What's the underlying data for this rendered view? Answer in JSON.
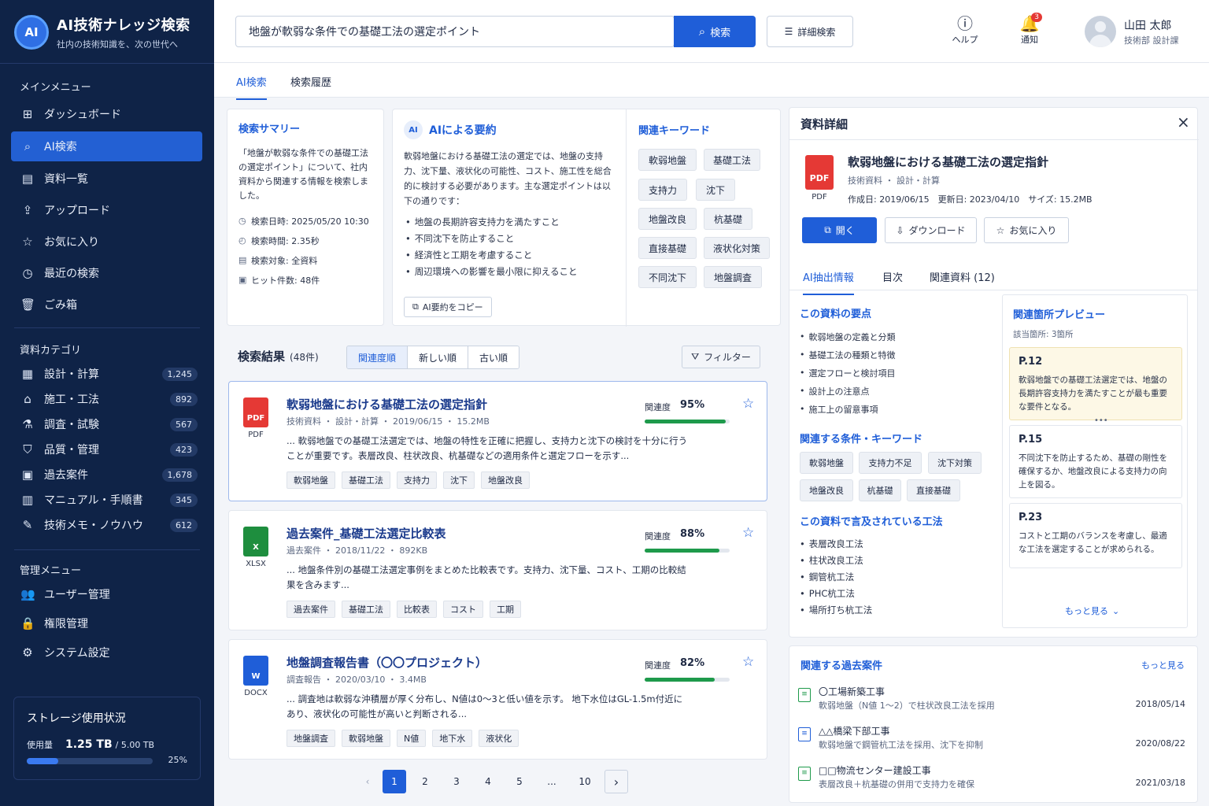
{
  "brand": {
    "title": "AI技術ナレッジ検索",
    "subtitle": "社内の技術知識を、次の世代へ",
    "logo_text": "AI"
  },
  "sidebar": {
    "main_heading": "メインメニュー",
    "main_items": [
      {
        "label": "ダッシュボード",
        "icon": "grid-icon"
      },
      {
        "label": "AI検索",
        "icon": "search-icon",
        "active": true
      },
      {
        "label": "資料一覧",
        "icon": "list-icon"
      },
      {
        "label": "アップロード",
        "icon": "upload-icon"
      },
      {
        "label": "お気に入り",
        "icon": "star-icon"
      },
      {
        "label": "最近の検索",
        "icon": "clock-icon"
      },
      {
        "label": "ごみ箱",
        "icon": "trash-icon"
      }
    ],
    "category_heading": "資料カテゴリ",
    "categories": [
      {
        "label": "設計・計算",
        "count": "1,245"
      },
      {
        "label": "施工・工法",
        "count": "892"
      },
      {
        "label": "調査・試験",
        "count": "567"
      },
      {
        "label": "品質・管理",
        "count": "423"
      },
      {
        "label": "過去案件",
        "count": "1,678"
      },
      {
        "label": "マニュアル・手順書",
        "count": "345"
      },
      {
        "label": "技術メモ・ノウハウ",
        "count": "612"
      }
    ],
    "admin_heading": "管理メニュー",
    "admin_items": [
      {
        "label": "ユーザー管理",
        "icon": "users-icon"
      },
      {
        "label": "権限管理",
        "icon": "lock-icon"
      },
      {
        "label": "システム設定",
        "icon": "gear-icon"
      }
    ],
    "storage": {
      "title": "ストレージ使用状況",
      "used_label": "使用量",
      "used": "1.25 TB",
      "total": "/ 5.00 TB",
      "percent_label": "25%",
      "percent": 25
    }
  },
  "topbar": {
    "search_value": "地盤が軟弱な条件での基礎工法の選定ポイント",
    "search_button": "検索",
    "advanced_button": "詳細検索",
    "help_label": "ヘルプ",
    "notify_label": "通知",
    "notify_count": "3",
    "user_name": "山田 太郎",
    "user_dept": "技術部 設計課"
  },
  "tabs": [
    "AI検索",
    "検索履歴"
  ],
  "summary": {
    "title": "検索サマリー",
    "text": "「地盤が軟弱な条件での基礎工法の選定ポイント」について、社内資料から関連する情報を検索しました。",
    "meta": [
      {
        "label": "検索日時: 2025/05/20 10:30"
      },
      {
        "label": "検索時間: 2.35秒"
      },
      {
        "label": "検索対象: 全資料"
      },
      {
        "label": "ヒット件数: 48件"
      }
    ]
  },
  "ai_summary": {
    "badge": "AI",
    "title": "AIによる要約",
    "text": "軟弱地盤における基礎工法の選定では、地盤の支持力、沈下量、液状化の可能性、コスト、施工性を総合的に検討する必要があります。主な選定ポイントは以下の通りです：",
    "points": [
      "地盤の長期許容支持力を満たすこと",
      "不同沈下を防止すること",
      "経済性と工期を考慮すること",
      "周辺環境への影響を最小限に抑えること"
    ],
    "copy_button": "AI要約をコピー"
  },
  "keywords": {
    "title": "関連キーワード",
    "items": [
      "軟弱地盤",
      "基礎工法",
      "支持力",
      "沈下",
      "地盤改良",
      "杭基礎",
      "直接基礎",
      "液状化対策",
      "不同沈下",
      "地盤調査"
    ]
  },
  "results": {
    "title": "検索結果",
    "count": "(48件)",
    "sort": [
      "関連度順",
      "新しい順",
      "古い順"
    ],
    "filter": "フィルター",
    "relevance_label": "関連度",
    "items": [
      {
        "type": "PDF",
        "icon_text": "PDF",
        "color": "#e53935",
        "title": "軟弱地盤における基礎工法の選定指針",
        "meta": "技術資料 ・ 設計・計算 ・ 2019/06/15 ・ 15.2MB",
        "snippet": "... 軟弱地盤での基礎工法選定では、地盤の特性を正確に把握し、支持力と沈下の検討を十分に行うことが重要です。表層改良、柱状改良、杭基礎などの適用条件と選定フローを示す...",
        "relevance": "95%",
        "relevance_value": 95,
        "tags": [
          "軟弱地盤",
          "基礎工法",
          "支持力",
          "沈下",
          "地盤改良"
        ]
      },
      {
        "type": "XLSX",
        "icon_text": "X",
        "color": "#1e8e3e",
        "title": "過去案件_基礎工法選定比較表",
        "meta": "過去案件 ・ 2018/11/22 ・ 892KB",
        "snippet": "... 地盤条件別の基礎工法選定事例をまとめた比較表です。支持力、沈下量、コスト、工期の比較結果を含みます...",
        "relevance": "88%",
        "relevance_value": 88,
        "tags": [
          "過去案件",
          "基礎工法",
          "比較表",
          "コスト",
          "工期"
        ]
      },
      {
        "type": "DOCX",
        "icon_text": "W",
        "color": "#1f5ed8",
        "title": "地盤調査報告書（〇〇プロジェクト）",
        "meta": "調査報告 ・ 2020/03/10 ・ 3.4MB",
        "snippet": "... 調査地は軟弱な沖積層が厚く分布し、N値は0〜3と低い値を示す。 地下水位はGL-1.5m付近にあり、液状化の可能性が高いと判断される...",
        "relevance": "82%",
        "relevance_value": 82,
        "tags": [
          "地盤調査",
          "軟弱地盤",
          "N値",
          "地下水",
          "液状化"
        ]
      }
    ],
    "pages": [
      "1",
      "2",
      "3",
      "4",
      "5",
      "...",
      "10"
    ]
  },
  "detail": {
    "header": "資料詳細",
    "title": "軟弱地盤における基礎工法の選定指針",
    "type": "PDF",
    "category": "技術資料 ・ 設計・計算",
    "dates": "作成日: 2019/06/15　更新日: 2023/04/10　サイズ: 15.2MB",
    "open_button": "開く",
    "download_button": "ダウンロード",
    "favorite_button": "お気に入り",
    "tabs": [
      "AI抽出情報",
      "目次",
      "関連資料 (12)"
    ],
    "key_points_title": "この資料の要点",
    "key_points": [
      "軟弱地盤の定義と分類",
      "基礎工法の種類と特徴",
      "選定フローと検討項目",
      "設計上の注意点",
      "施工上の留意事項"
    ],
    "conditions_title": "関連する条件・キーワード",
    "conditions": [
      "軟弱地盤",
      "支持力不足",
      "沈下対策",
      "地盤改良",
      "杭基礎",
      "直接基礎"
    ],
    "methods_title": "この資料で言及されている工法",
    "methods": [
      "表層改良工法",
      "柱状改良工法",
      "鋼管杭工法",
      "PHC杭工法",
      "場所打ち杭工法"
    ],
    "preview_title": "関連箇所プレビュー",
    "preview_sub": "該当箇所: 3箇所",
    "previews": [
      {
        "page": "P.12",
        "text": "軟弱地盤での基礎工法選定では、地盤の長期許容支持力を満たすことが最も重要な要件となる。"
      },
      {
        "page": "P.15",
        "text": "不同沈下を防止するため、基礎の剛性を確保するか、地盤改良による支持力の向上を図る。"
      },
      {
        "page": "P.23",
        "text": "コストと工期のバランスを考慮し、最適な工法を選定することが求められる。"
      }
    ],
    "more": "もっと見る"
  },
  "cases": {
    "title": "関連する過去案件",
    "more": "もっと見る",
    "items": [
      {
        "title": "〇工場新築工事",
        "desc": "軟弱地盤（N値 1〜2）で柱状改良工法を採用",
        "date": "2018/05/14"
      },
      {
        "title": "△△橋梁下部工事",
        "desc": "軟弱地盤で鋼管杭工法を採用、沈下を抑制",
        "date": "2020/08/22"
      },
      {
        "title": "□□物流センター建設工事",
        "desc": "表層改良＋杭基礎の併用で支持力を確保",
        "date": "2021/03/18"
      }
    ]
  }
}
